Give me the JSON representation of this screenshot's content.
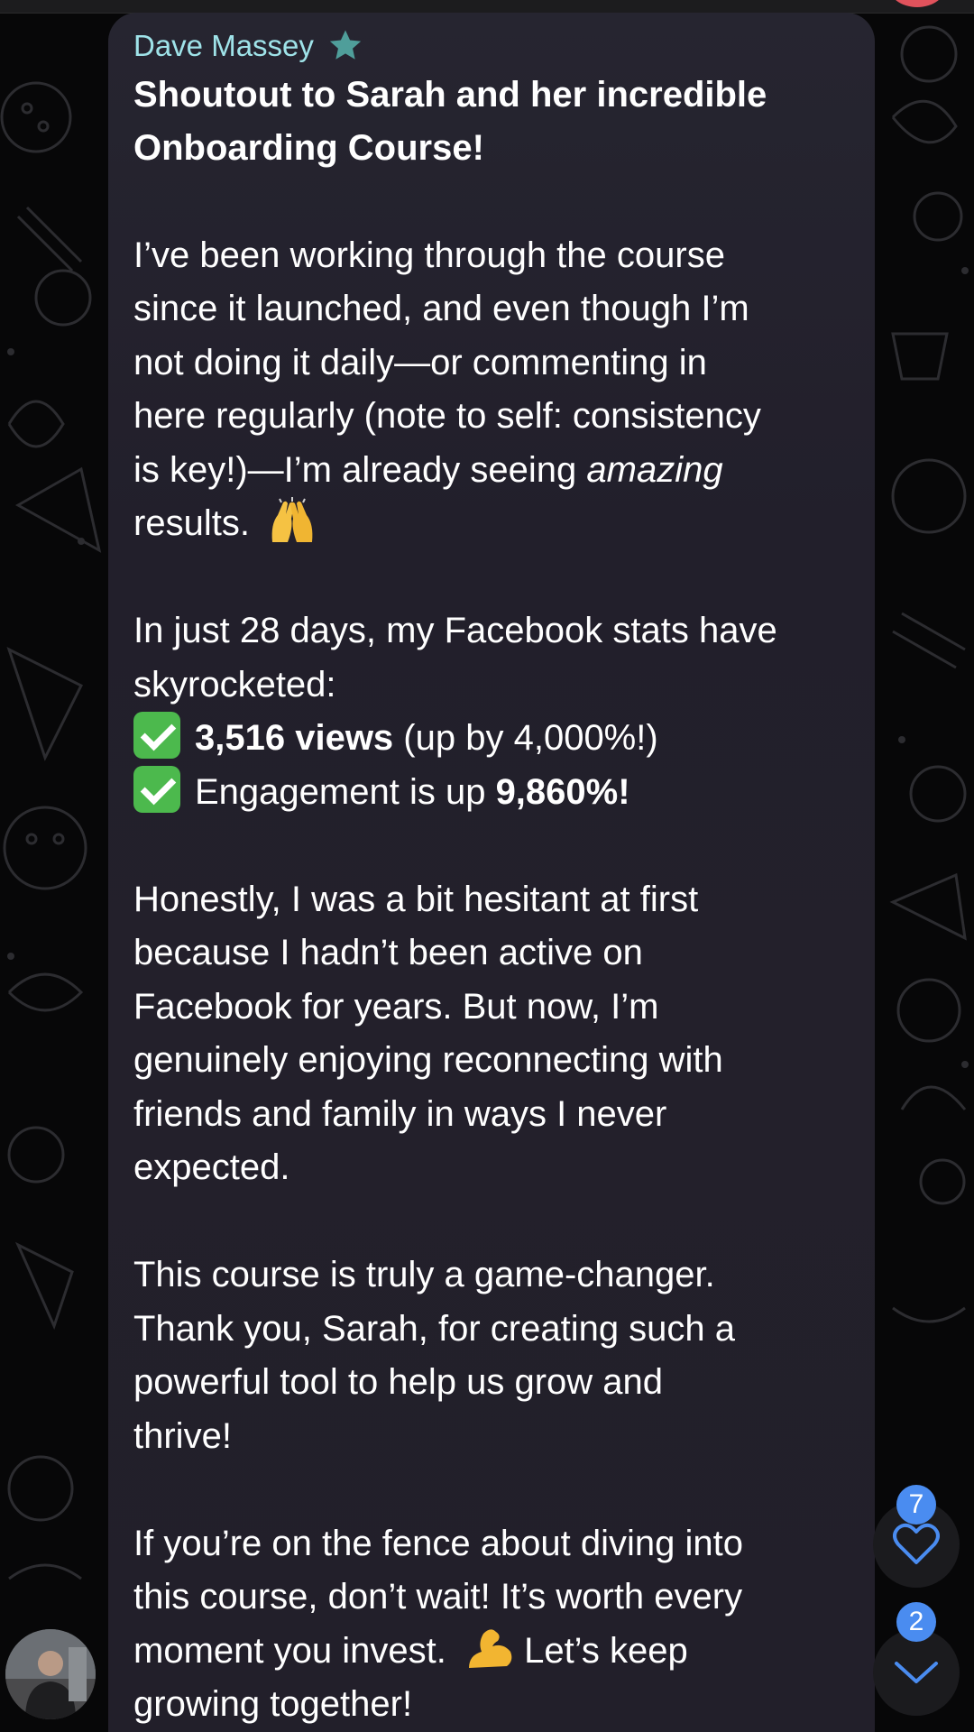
{
  "message": {
    "sender": "Dave Massey",
    "title_line1": "Shoutout to Sarah and her incredible",
    "title_line2": "Onboarding Course!",
    "p1": [
      "I’ve been working through the course",
      "since it launched, and even though I’m",
      "not doing it daily—or commenting in",
      "here regularly (note to self: consistency",
      "is key!)—I’m already seeing "
    ],
    "p1_italic": "amazing",
    "p1_end": "results.",
    "p2": [
      "In just 28 days, my Facebook stats have",
      "skyrocketed:"
    ],
    "stat1_bold": "3,516 views",
    "stat1_rest": " (up by 4,000%!)",
    "stat2_rest": "Engagement is up ",
    "stat2_bold": "9,860%!",
    "p3": [
      "Honestly, I was a bit hesitant at first",
      "because I hadn’t been active on",
      "Facebook for years. But now, I’m",
      "genuinely enjoying reconnecting with",
      "friends and family in ways I never",
      "expected."
    ],
    "p4": [
      "This course is truly a game-changer.",
      "Thank you, Sarah, for creating such a",
      "powerful tool to help us grow and",
      "thrive!"
    ],
    "p5": [
      "If you’re on the fence about diving into",
      "this course, don’t wait! It’s worth every",
      "moment you invest."
    ],
    "p5_end": "Let’s keep",
    "p5_last": "growing together!"
  },
  "reactions": {
    "count": "7"
  },
  "scroll_down": {
    "count": "2"
  },
  "colors": {
    "sender": "#9fe3e9",
    "badge": "#4a8cf0",
    "accent": "#4a8cf0",
    "check": "#4cb94d"
  },
  "icons": [
    "star-icon",
    "raising-hands-icon",
    "check-mark-icon",
    "flexed-biceps-icon",
    "heart-icon",
    "chevron-down-icon"
  ]
}
